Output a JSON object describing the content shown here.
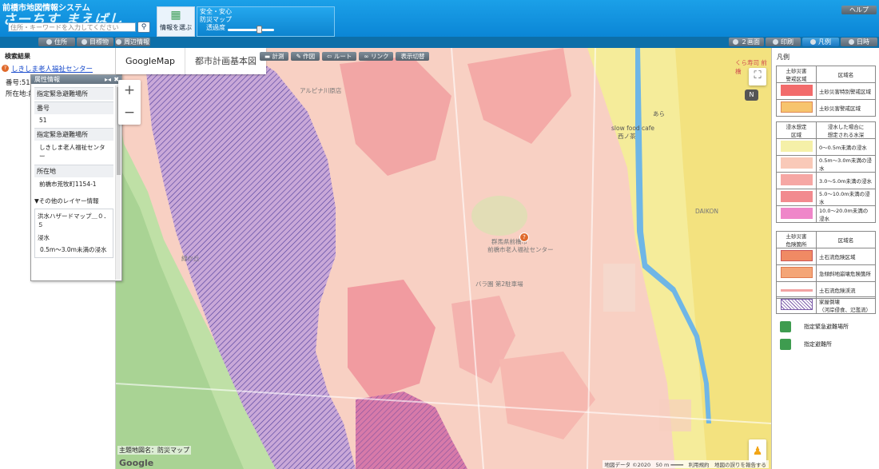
{
  "header": {
    "system_name": "前橋市地図情報システム",
    "logo_text": "さーちす まえばし",
    "search_placeholder": "住所・キーワードを入力してください",
    "info_select_label": "情報を選ぶ",
    "theme_line1": "安全・安心",
    "theme_line2": "防災マップ",
    "opacity_label": "透過度",
    "opacity_value": 0.6,
    "help_label": "ヘルプ"
  },
  "toolbar": {
    "address_label": "住所",
    "landmark_label": "目標物",
    "nearby_label": "周辺情報",
    "two_screen_label": "２画面",
    "print_label": "印刷",
    "legend_label": "凡例",
    "date_label": "日時"
  },
  "results": {
    "title": "検索結果",
    "item_name": "しきしま老人福祉センター",
    "number_line": "番号:51",
    "address_line": "所在地:前"
  },
  "attr_popup": {
    "title": "属性情報",
    "facility_type": "指定緊急避難場所",
    "label_number": "番号",
    "value_number": "51",
    "label_facility": "指定緊急避難場所",
    "value_facility": "しきしま老人福祉センター",
    "label_address": "所在地",
    "value_address": "前橋市荒牧町1154-1",
    "other_layers_title": "▼その他のレイヤー情報",
    "layer_name": "洪水ハザードマップ＿０．５",
    "label_flood": "浸水",
    "value_flood": "0.5m～3.0m未満の浸水"
  },
  "map": {
    "tab_google": "GoogleMap",
    "tab_city": "都市計画基本図",
    "tool_measure": "計測",
    "tool_draw": "作図",
    "tool_route": "ルート",
    "tool_link": "リンク",
    "tool_display": "表示切替",
    "theme_name": "主題地図名：防災マップ",
    "google_logo": "Google",
    "attribution": "地図データ ©2020　50 m ━━━━　利用規約　地図の誤りを報告する",
    "compass": "N",
    "labels": {
      "l1": "アルピナ川原店",
      "l2": "slow food cafe",
      "l3": "西ノ茶",
      "l4": "あら",
      "l5": "緑か丘",
      "l6": "バラ園 第2駐車場",
      "l7": "群馬県前橋市",
      "l8": "前橋市老人福祉センター",
      "l9": "くら寿司 前橋",
      "l10": "DAIKON"
    }
  },
  "legend": {
    "title": "凡例",
    "sediment_header1": "土砂災害\n警戒区域",
    "sediment_header2": "区域名",
    "sediment_row1": "土砂災害特別警戒区域",
    "sediment_row2": "土砂災害警戒区域",
    "flood_header1": "浸水想定\n区域",
    "flood_header2": "浸水した場合に\n想定される水深",
    "flood_rows": [
      "0～0.5m未満の浸水",
      "0.5m～3.0m未満の浸水",
      "3.0～5.0m未満の浸水",
      "5.0～10.0m未満の浸水",
      "10.0～20.0m未満の浸水"
    ],
    "hazard_header1": "土砂災害\n危険箇所",
    "hazard_header2": "区域名",
    "hazard_rows": [
      "土石流危険区域",
      "急傾斜地崩壊危険箇所",
      "土石流危険渓流"
    ],
    "house_collapse": "家屋倒壊\n（河岸侵食、氾濫流）",
    "designated_emergency": "指定緊急避難場所",
    "designated_shelter": "指定避難所",
    "colors": {
      "sediment_special": "#f26b6b",
      "sediment_warning": "#f7c46e",
      "flood_0": "#f5f0a8",
      "flood_1": "#f9c9b8",
      "flood_2": "#f6a7a4",
      "flood_3": "#f28a8f",
      "flood_4": "#ef86c9",
      "debris": "#f08a64",
      "steep": "#f4a577",
      "stream": "#f2a3a3",
      "collapse": "#7a5aa8"
    }
  }
}
